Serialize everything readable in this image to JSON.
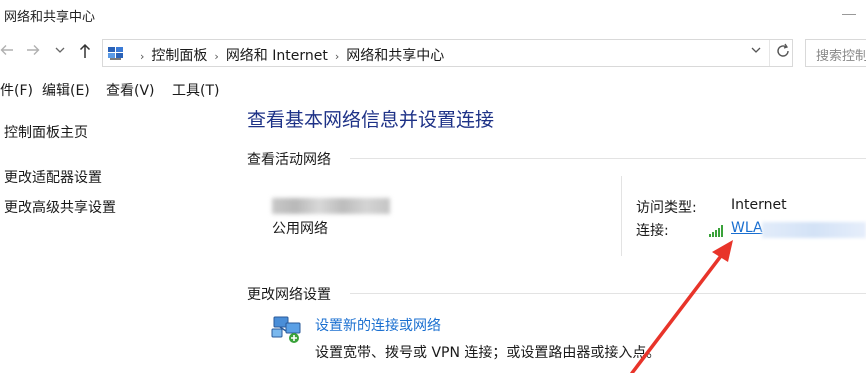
{
  "window": {
    "title": "网络和共享中心"
  },
  "nav": {
    "back_icon": "arrow-left-icon",
    "forward_icon": "arrow-right-icon",
    "recent_icon": "chevron-down-icon",
    "up_icon": "arrow-up-icon",
    "breadcrumbs": [
      "控制面板",
      "网络和 Internet",
      "网络和共享中心"
    ],
    "refresh_icon": "refresh-icon",
    "search_placeholder": "搜索控制"
  },
  "menu": [
    "件(F)",
    "编辑(E)",
    "查看(V)",
    "工具(T)"
  ],
  "sidebar": {
    "items": [
      "控制面板主页",
      "更改适配器设置",
      "更改高级共享设置"
    ]
  },
  "main": {
    "heading": "查看基本网络信息并设置连接",
    "active_section": "查看活动网络",
    "network_type": "公用网络",
    "access_type_label": "访问类型:",
    "access_type_value": "Internet",
    "connection_label": "连接:",
    "connection_value": "WLA",
    "change_section": "更改网络设置",
    "setup_link": "设置新的连接或网络",
    "setup_desc": "设置宽带、拨号或 VPN 连接；或设置路由器或接入点。"
  },
  "colors": {
    "heading": "#1e3287",
    "link": "#1a6fd0",
    "annotation_arrow": "#e8342a"
  }
}
